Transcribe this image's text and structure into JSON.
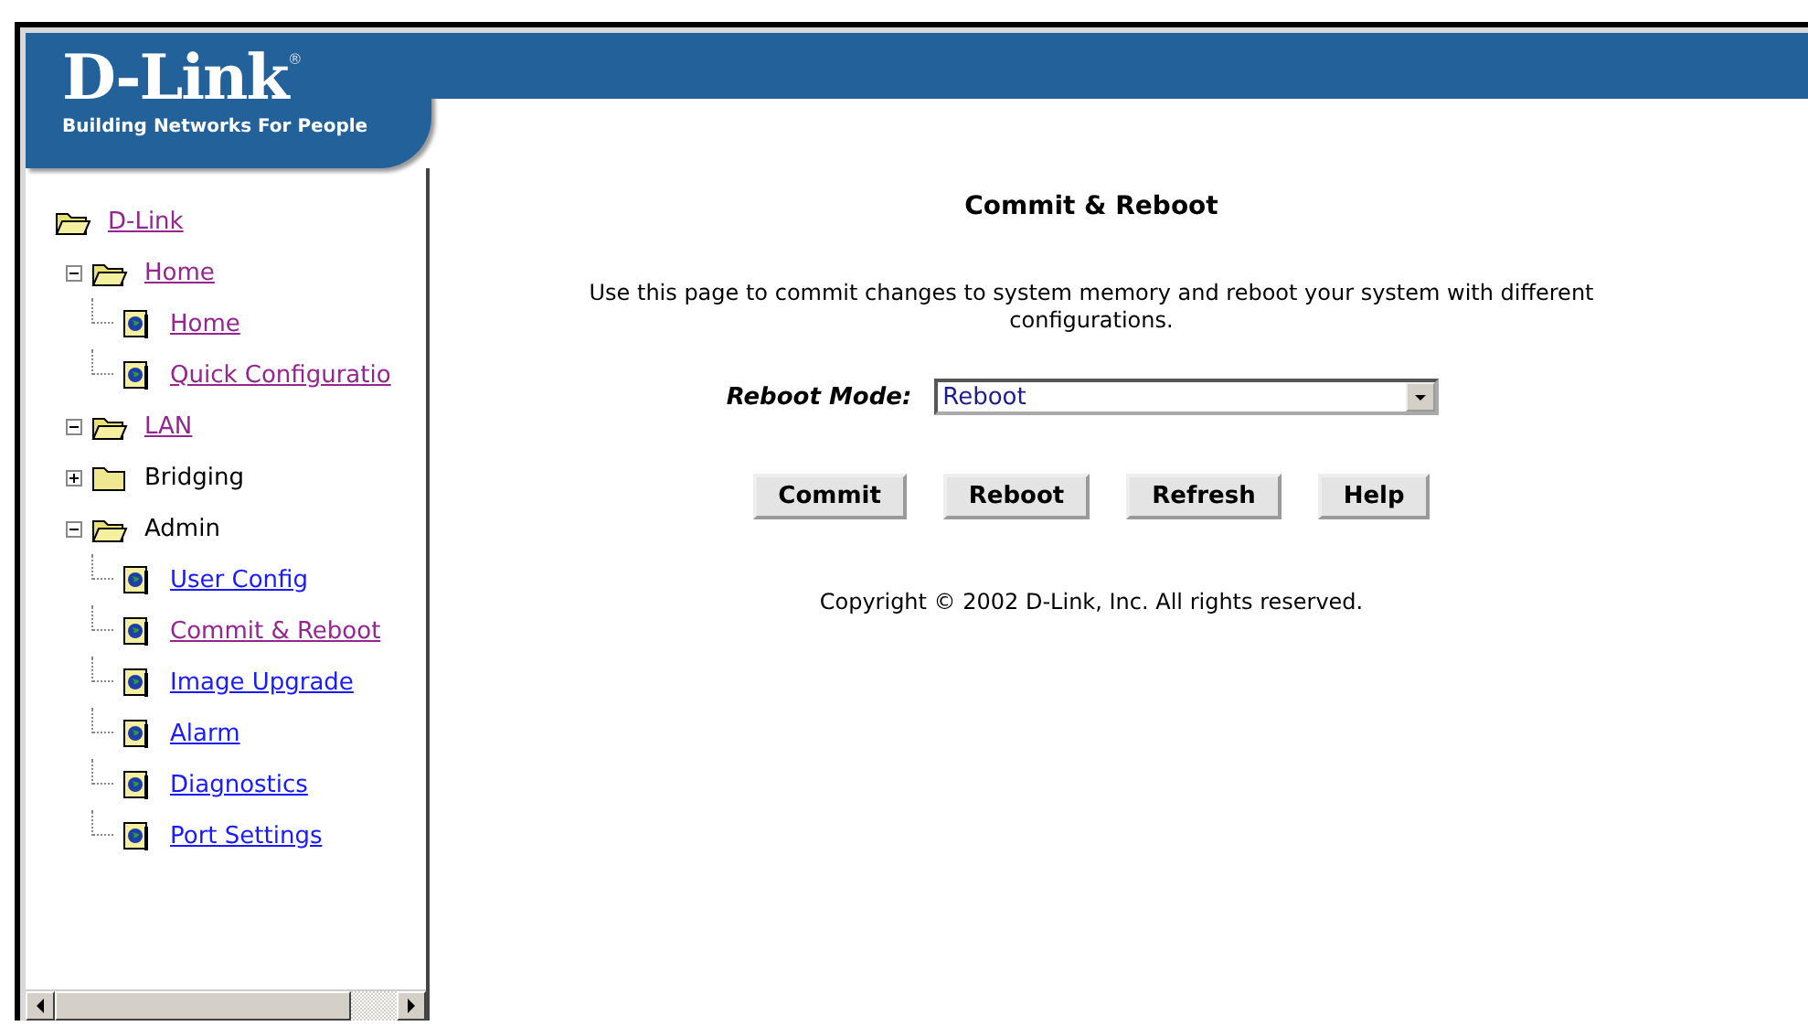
{
  "logo": {
    "brand": "D-Link",
    "mark": "®",
    "tagline": "Building Networks For People"
  },
  "tree": [
    {
      "label": "D-Link",
      "kind": "folder",
      "link": true,
      "visited": true,
      "expanded": true,
      "children": [
        {
          "label": "Home",
          "kind": "folder",
          "link": true,
          "visited": true,
          "expanded": true,
          "children": [
            {
              "label": "Home",
              "kind": "page",
              "link": true,
              "visited": true
            },
            {
              "label": "Quick Configuratio",
              "kind": "page",
              "link": true,
              "visited": true
            }
          ]
        },
        {
          "label": "LAN",
          "kind": "folder",
          "link": true,
          "visited": true,
          "expanded": true
        },
        {
          "label": "Bridging",
          "kind": "folder",
          "link": false,
          "expanded": false
        },
        {
          "label": "Admin",
          "kind": "folder",
          "link": false,
          "expanded": true,
          "children": [
            {
              "label": "User Config",
              "kind": "page",
              "link": true,
              "visited": false
            },
            {
              "label": "Commit & Reboot",
              "kind": "page",
              "link": true,
              "visited": true
            },
            {
              "label": "Image Upgrade",
              "kind": "page",
              "link": true,
              "visited": false
            },
            {
              "label": "Alarm",
              "kind": "page",
              "link": true,
              "visited": false
            },
            {
              "label": "Diagnostics",
              "kind": "page",
              "link": true,
              "visited": false
            },
            {
              "label": "Port Settings",
              "kind": "page",
              "link": true,
              "visited": false
            }
          ]
        }
      ]
    }
  ],
  "page": {
    "title": "Commit & Reboot",
    "description": "Use this page to commit changes to system memory and reboot your system with different configurations.",
    "reboot_mode": {
      "label": "Reboot Mode:",
      "value": "Reboot"
    },
    "buttons": [
      "Commit",
      "Reboot",
      "Refresh",
      "Help"
    ],
    "copyright": "Copyright © 2002 D-Link, Inc. All rights reserved."
  }
}
